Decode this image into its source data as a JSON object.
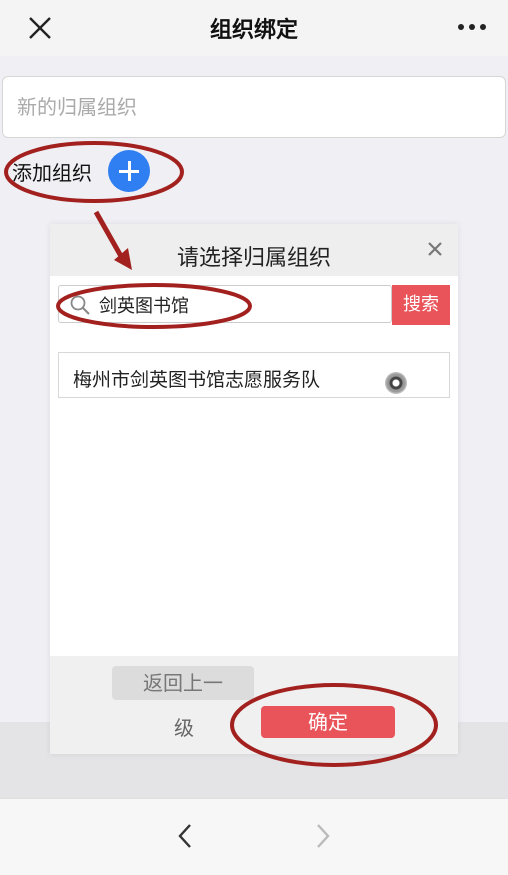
{
  "header": {
    "title": "组织绑定"
  },
  "form": {
    "org_placeholder": "新的归属组织",
    "add_label": "添加组织"
  },
  "dialog": {
    "title": "请选择归属组织",
    "search_value": "剑英图书馆",
    "search_button": "搜索",
    "results": [
      {
        "name": "梅州市剑英图书馆志愿服务队",
        "selected": true
      }
    ],
    "back_button_line1": "返回上一",
    "back_button_line2": "级",
    "confirm_button": "确定"
  },
  "colors": {
    "accent_red": "#e8545a",
    "add_blue": "#2f7ff2",
    "annotation": "#a2211f"
  },
  "icons": {
    "close": "close-icon",
    "more": "more-icon",
    "add": "plus-icon",
    "search": "search-icon",
    "back": "chevron-left-icon",
    "forward": "chevron-right-icon"
  }
}
